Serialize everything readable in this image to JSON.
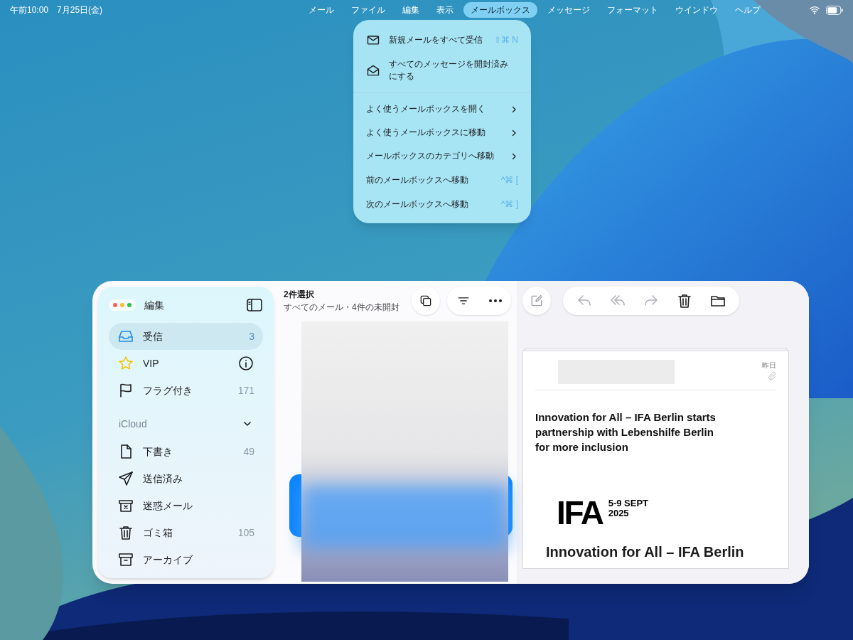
{
  "status_bar": {
    "time": "午前10:00",
    "date": "7月25日(金)"
  },
  "menu_bar": [
    {
      "label": "メール",
      "selected": false
    },
    {
      "label": "ファイル",
      "selected": false
    },
    {
      "label": "編集",
      "selected": false
    },
    {
      "label": "表示",
      "selected": false
    },
    {
      "label": "メールボックス",
      "selected": true
    },
    {
      "label": "メッセージ",
      "selected": false
    },
    {
      "label": "フォーマット",
      "selected": false
    },
    {
      "label": "ウインドウ",
      "selected": false
    },
    {
      "label": "ヘルプ",
      "selected": false
    }
  ],
  "menu": {
    "sections": [
      {
        "items": [
          {
            "kind": "fetch",
            "label": "新規メールをすべて受信",
            "shortcut": "⇧⌘ N"
          },
          {
            "kind": "markread",
            "label": "すべてのメッセージを開封済みにする"
          }
        ]
      },
      {
        "items": [
          {
            "kind": "submenu",
            "label": "よく使うメールボックスを開く"
          },
          {
            "kind": "submenu",
            "label": "よく使うメールボックスに移動"
          },
          {
            "kind": "submenu",
            "label": "メールボックスのカテゴリへ移動"
          },
          {
            "kind": "shortcut",
            "label": "前のメールボックスへ移動",
            "shortcut": "^⌘ ["
          },
          {
            "kind": "shortcut",
            "label": "次のメールボックスへ移動",
            "shortcut": "^⌘ ]"
          }
        ]
      }
    ]
  },
  "sidebar": {
    "edit": "編集",
    "favorites": [
      {
        "kind": "inbox",
        "label": "受信",
        "count": "3",
        "selected": true
      },
      {
        "kind": "vip",
        "label": "VIP",
        "selected": false
      },
      {
        "kind": "flagged",
        "label": "フラグ付き",
        "count": "171",
        "selected": false
      }
    ],
    "account": {
      "label": "iCloud",
      "expanded": true,
      "items": [
        {
          "kind": "drafts",
          "label": "下書き",
          "count": "49",
          "selected": false
        },
        {
          "kind": "sent",
          "label": "送信済み",
          "selected": false
        },
        {
          "kind": "junk",
          "label": "迷惑メール",
          "selected": false
        },
        {
          "kind": "trash",
          "label": "ゴミ箱",
          "count": "105",
          "selected": false
        },
        {
          "kind": "archive",
          "label": "アーカイブ",
          "selected": false
        }
      ]
    }
  },
  "message_list": {
    "title": "2件選択",
    "subtitle": "すべてのメール・4件の未開封"
  },
  "viewer": {
    "toolbar": [
      {
        "kind": "reply",
        "disabled": true
      },
      {
        "kind": "replyall",
        "disabled": true
      },
      {
        "kind": "forward",
        "disabled": true
      },
      {
        "kind": "trash",
        "disabled": false
      },
      {
        "kind": "folder",
        "disabled": false
      }
    ],
    "date": "昨日",
    "headline": "Innovation for All – IFA Berlin starts partnership with Lebenshilfe Berlin for more inclusion",
    "logo": "IFA",
    "logo_dates": [
      "5-9 SEPT",
      "2025"
    ],
    "subheading": "Innovation for All – IFA Berlin"
  }
}
